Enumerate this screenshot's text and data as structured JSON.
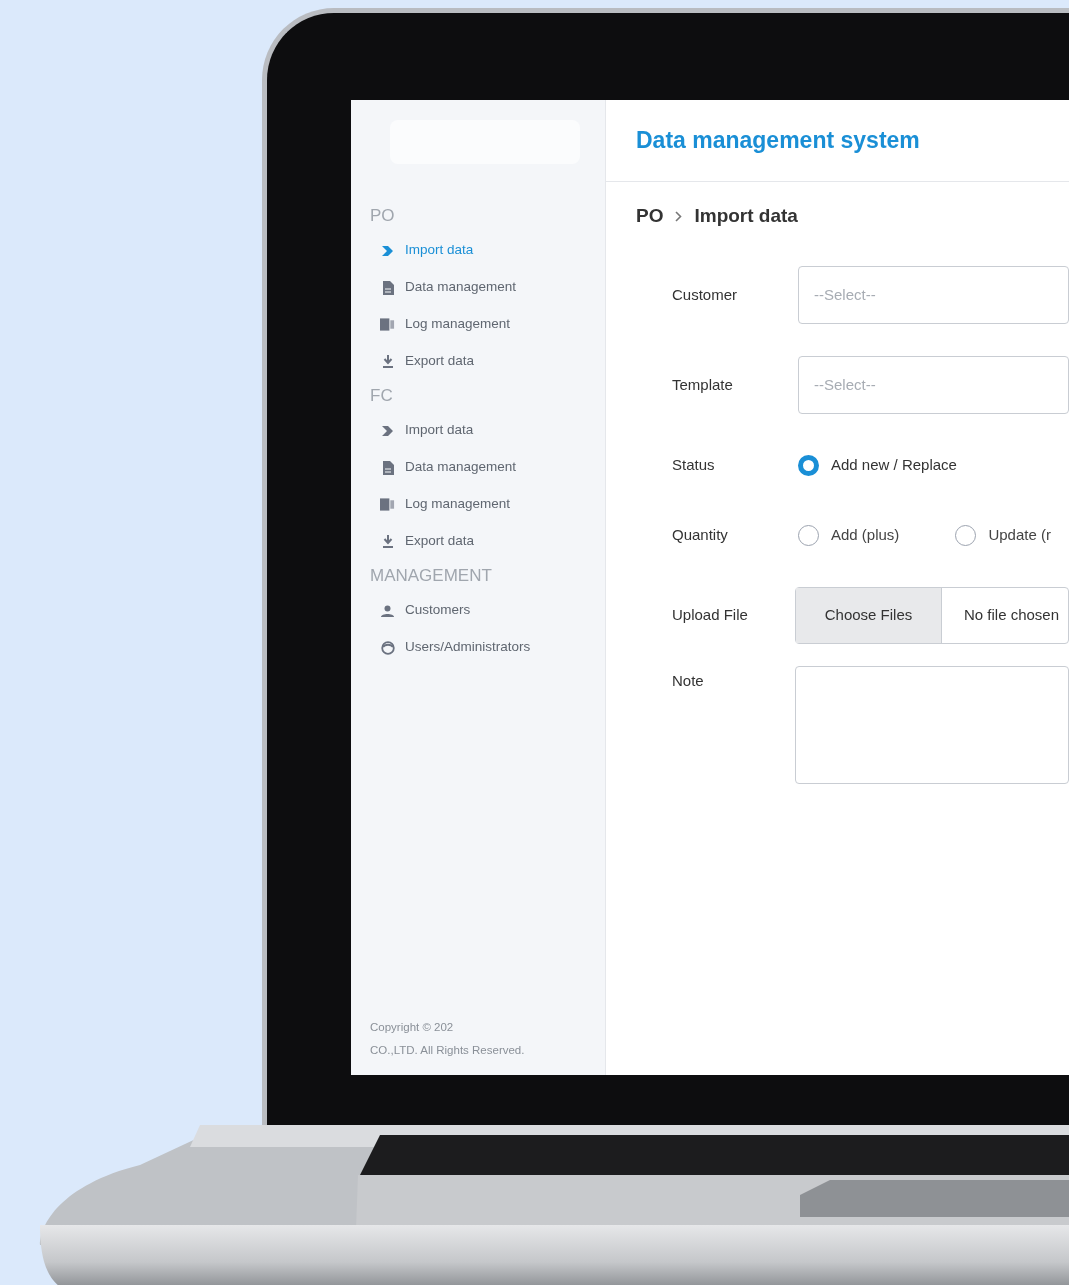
{
  "header": {
    "title": "Data management system"
  },
  "sidebar": {
    "sections": [
      {
        "heading": "PO",
        "items": [
          {
            "label": "Import data",
            "selected": true
          },
          {
            "label": "Data management",
            "selected": false
          },
          {
            "label": "Log management",
            "selected": false
          },
          {
            "label": "Export data",
            "selected": false
          }
        ]
      },
      {
        "heading": "FC",
        "items": [
          {
            "label": "Import data",
            "selected": false
          },
          {
            "label": "Data management",
            "selected": false
          },
          {
            "label": "Log management",
            "selected": false
          },
          {
            "label": "Export data",
            "selected": false
          }
        ]
      },
      {
        "heading": "MANAGEMENT",
        "items": [
          {
            "label": "Customers",
            "selected": false
          },
          {
            "label": "Users/Administrators",
            "selected": false
          }
        ]
      }
    ],
    "copyright": [
      "Copyright © 202",
      "CO.,LTD. All Rights Reserved."
    ]
  },
  "breadcrumb": [
    "PO",
    "Import data"
  ],
  "form": [
    {
      "kind": "select",
      "label": "Customer",
      "placeholder": "--Select--"
    },
    {
      "kind": "select",
      "label": "Template",
      "placeholder": "--Select--"
    },
    {
      "kind": "radio",
      "label": "Status",
      "options": [
        {
          "label": "Add new / Replace",
          "selected": true
        }
      ]
    },
    {
      "kind": "radio",
      "label": "Quantity",
      "options": [
        {
          "label": "Add (plus)",
          "selected": false
        },
        {
          "label": "Update (r",
          "selected": false
        }
      ]
    },
    {
      "kind": "file",
      "label": "Upload File",
      "button": "Choose Files",
      "value": "No file chosen"
    },
    {
      "kind": "textarea",
      "label": "Note"
    }
  ]
}
